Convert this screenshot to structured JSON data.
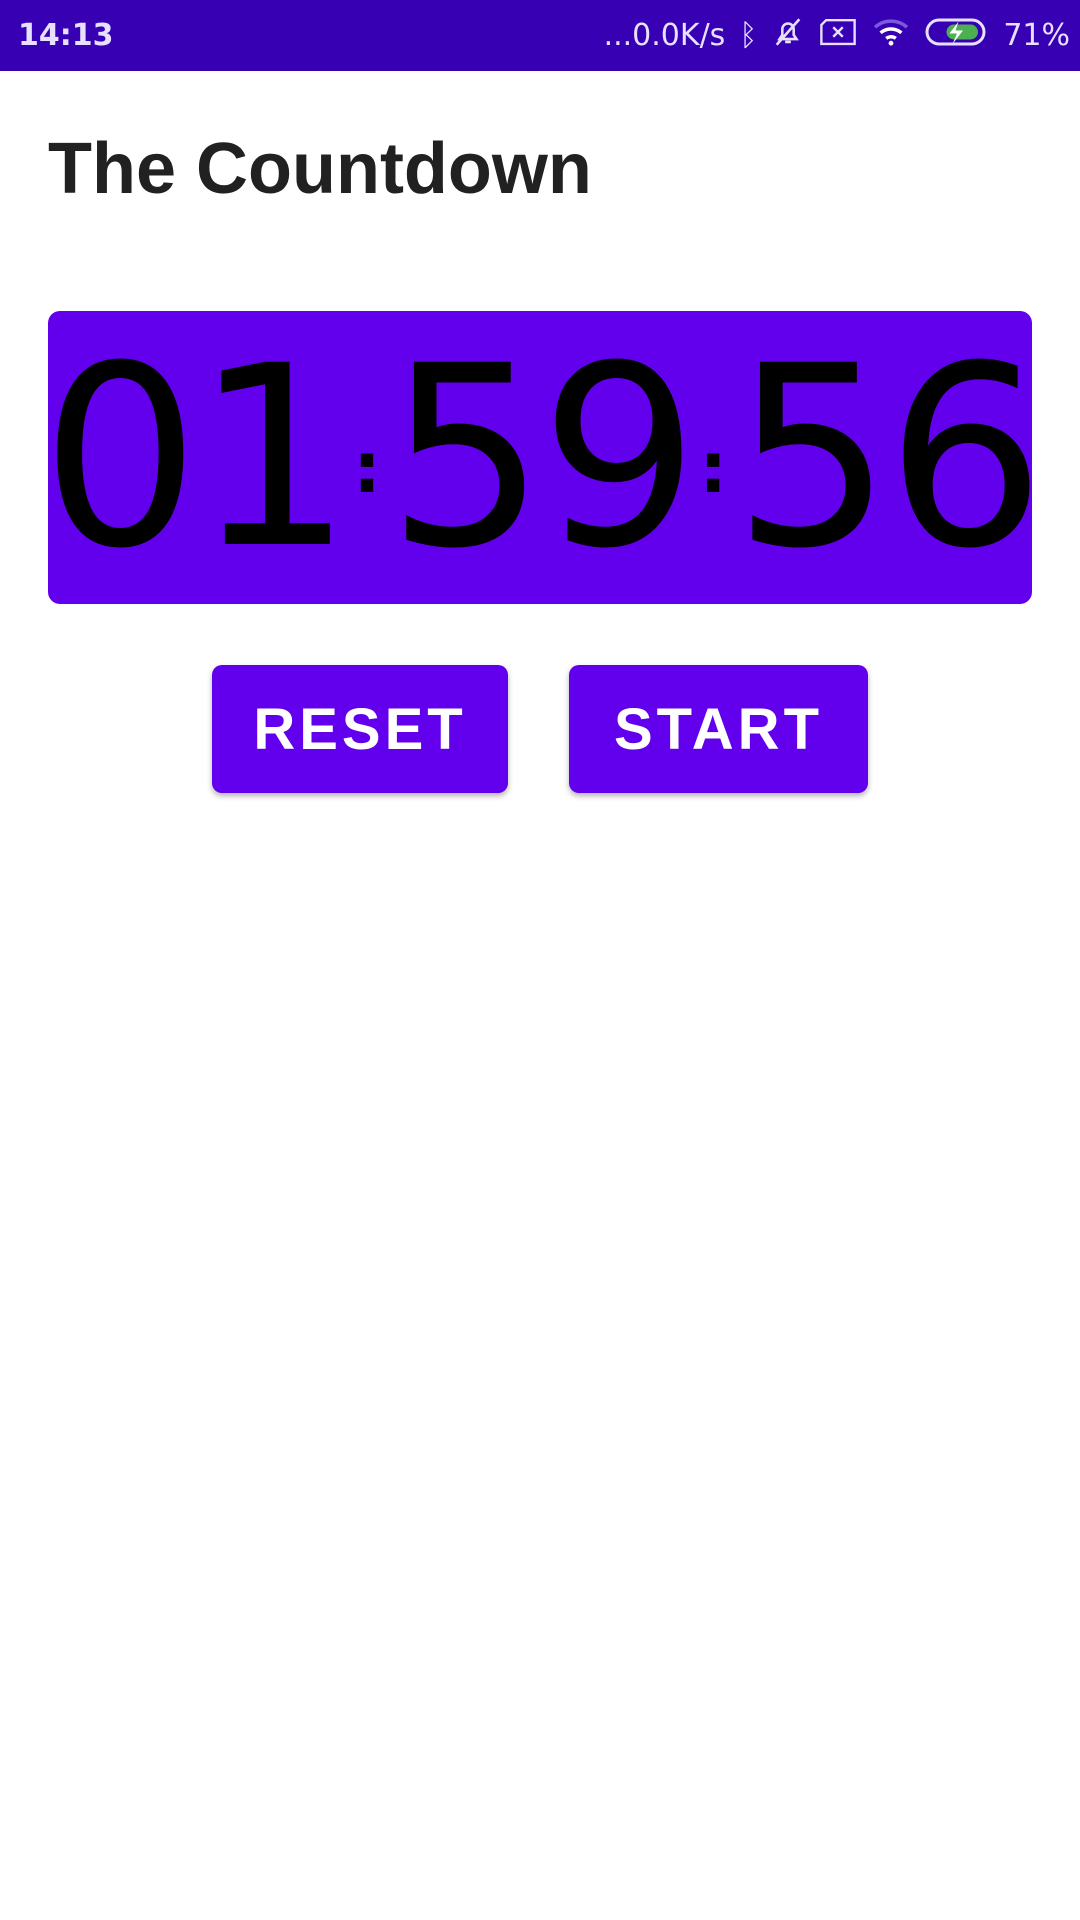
{
  "status_bar": {
    "time": "14:13",
    "net_speed": "...0.0K/s",
    "battery": "71%"
  },
  "app": {
    "title": "The Countdown"
  },
  "timer": {
    "hours": "01",
    "minutes": "59",
    "seconds": "56",
    "separator": ":"
  },
  "buttons": {
    "reset": "RESET",
    "start": "START"
  },
  "colors": {
    "primary": "#6200EE",
    "status_bar": "#3700B3"
  }
}
